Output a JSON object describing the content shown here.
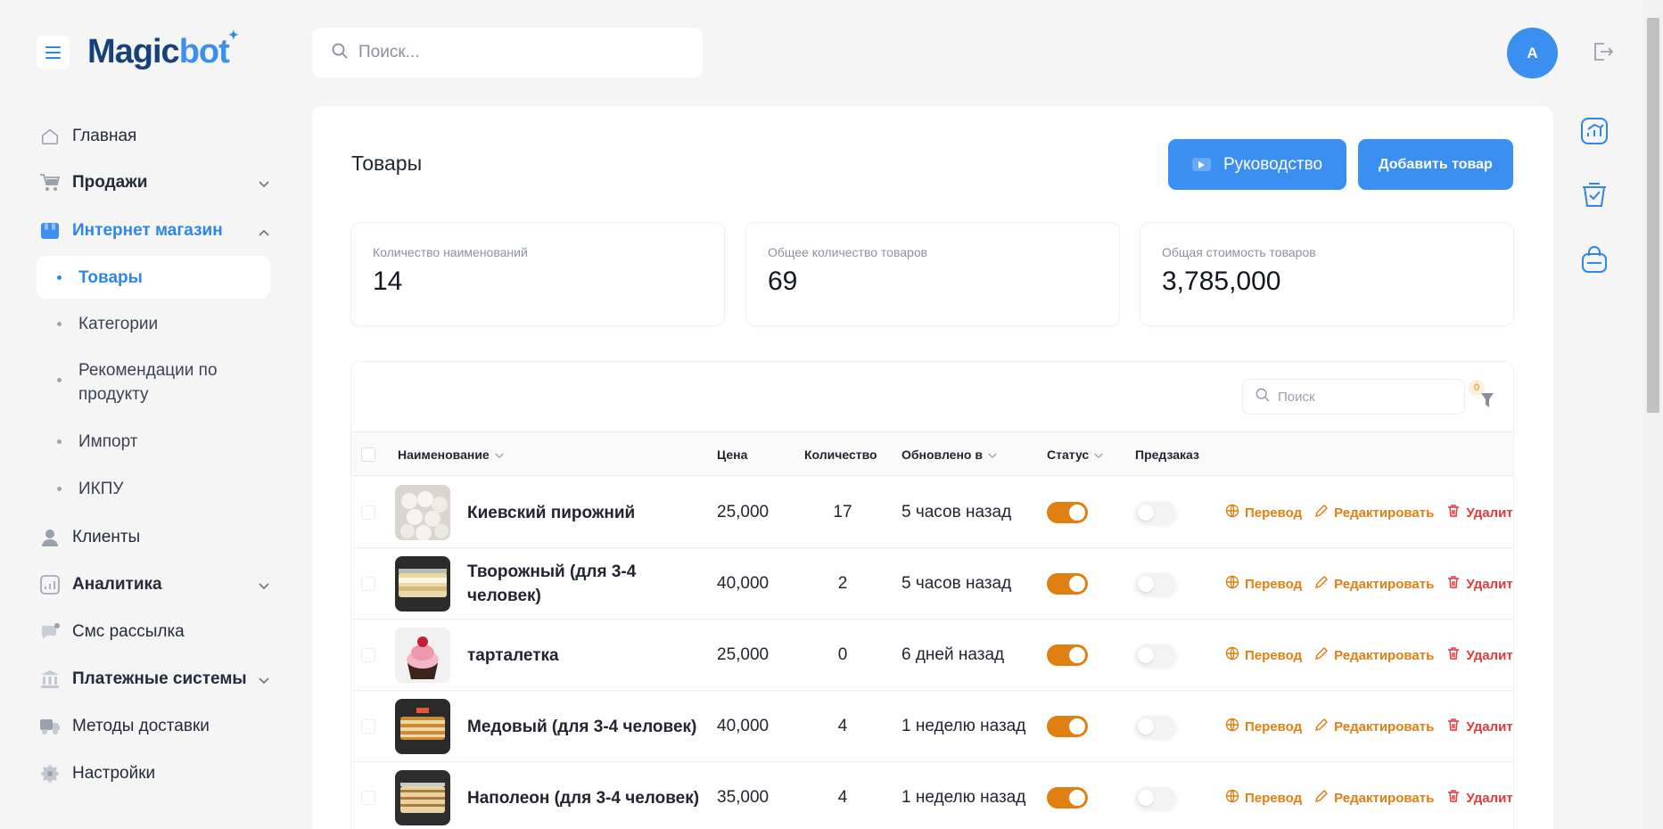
{
  "brand": {
    "part1": "Magic",
    "part2": "bot"
  },
  "top_search": {
    "placeholder": "Поиск..."
  },
  "user": {
    "initial": "A"
  },
  "sidebar": {
    "items": [
      {
        "label": "Главная"
      },
      {
        "label": "Продажи"
      },
      {
        "label": "Интернет магазин"
      },
      {
        "label": "Клиенты"
      },
      {
        "label": "Аналитика"
      },
      {
        "label": "Смс рассылка"
      },
      {
        "label": "Платежные системы"
      },
      {
        "label": "Методы доставки"
      },
      {
        "label": "Настройки"
      }
    ],
    "sub_items": [
      {
        "label": "Товары"
      },
      {
        "label": "Категории"
      },
      {
        "label": "Рекомендации по продукту"
      },
      {
        "label": "Импорт"
      },
      {
        "label": "ИКПУ"
      }
    ]
  },
  "page": {
    "title": "Товары",
    "guide_button": "Руководство",
    "add_button": "Добавить товар"
  },
  "stats": [
    {
      "label": "Количество наименований",
      "value": "14"
    },
    {
      "label": "Общее количество товаров",
      "value": "69"
    },
    {
      "label": "Общая стоимость товаров",
      "value": "3,785,000"
    }
  ],
  "table": {
    "search_placeholder": "Поиск",
    "filter_count": "0",
    "columns": {
      "name": "Наименование",
      "price": "Цена",
      "qty": "Количество",
      "updated": "Обновлено в",
      "status": "Статус",
      "preorder": "Предзаказ"
    },
    "actions": {
      "translate": "Перевод",
      "edit": "Редактировать",
      "delete": "Удалить"
    },
    "rows": [
      {
        "name": "Киевский пирожний",
        "price": "25,000",
        "qty": "17",
        "updated": "5 часов назад",
        "status": true,
        "preorder": false
      },
      {
        "name": "Творожный (для 3-4 человек)",
        "price": "40,000",
        "qty": "2",
        "updated": "5 часов назад",
        "status": true,
        "preorder": false
      },
      {
        "name": "тарталетка",
        "price": "25,000",
        "qty": "0",
        "updated": "6 дней назад",
        "status": true,
        "preorder": false
      },
      {
        "name": "Медовый (для 3-4 человек)",
        "price": "40,000",
        "qty": "4",
        "updated": "1 неделю назад",
        "status": true,
        "preorder": false
      },
      {
        "name": "Наполеон (для 3-4 человек)",
        "price": "35,000",
        "qty": "4",
        "updated": "1 неделю назад",
        "status": true,
        "preorder": false
      }
    ]
  },
  "colors": {
    "accent": "#3b8ff0",
    "toggle_on": "#e07f12",
    "delete": "#e23b3b"
  }
}
